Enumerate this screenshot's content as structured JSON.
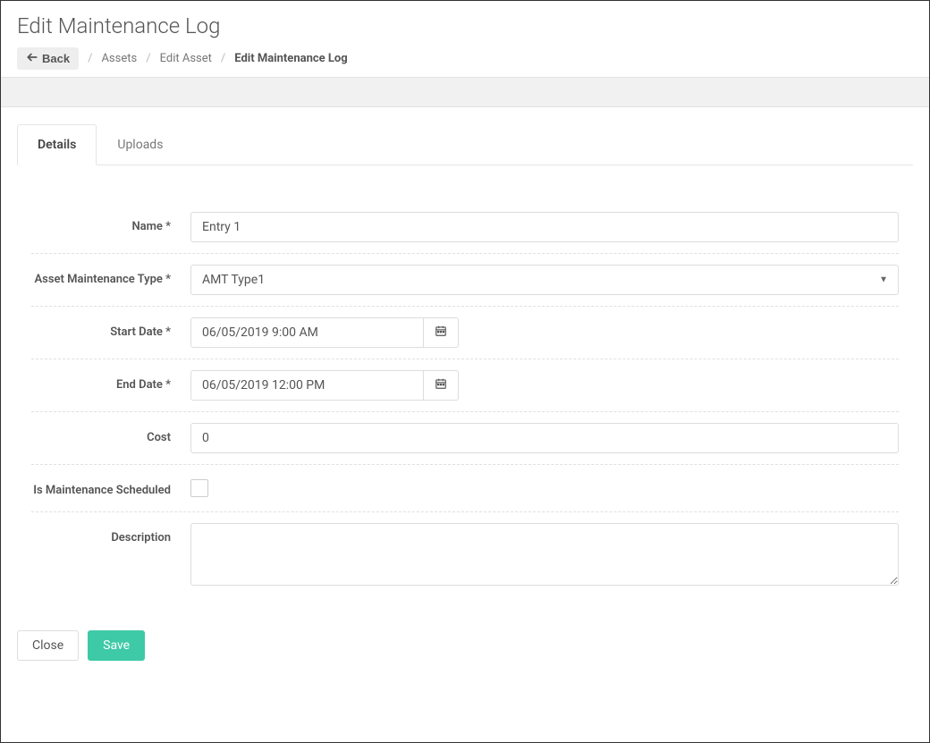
{
  "header": {
    "title": "Edit Maintenance Log",
    "back_label": "Back",
    "breadcrumbs": {
      "item0": "Assets",
      "item1": "Edit Asset",
      "current": "Edit Maintenance Log"
    }
  },
  "tabs": {
    "details": "Details",
    "uploads": "Uploads"
  },
  "form": {
    "name_label": "Name *",
    "name_value": "Entry 1",
    "type_label": "Asset Maintenance Type *",
    "type_value": "AMT Type1",
    "start_label": "Start Date *",
    "start_value": "06/05/2019 9:00 AM",
    "end_label": "End Date *",
    "end_value": "06/05/2019 12:00 PM",
    "cost_label": "Cost",
    "cost_value": "0",
    "scheduled_label": "Is Maintenance Scheduled",
    "scheduled_checked": false,
    "description_label": "Description",
    "description_value": ""
  },
  "footer": {
    "close_label": "Close",
    "save_label": "Save"
  }
}
